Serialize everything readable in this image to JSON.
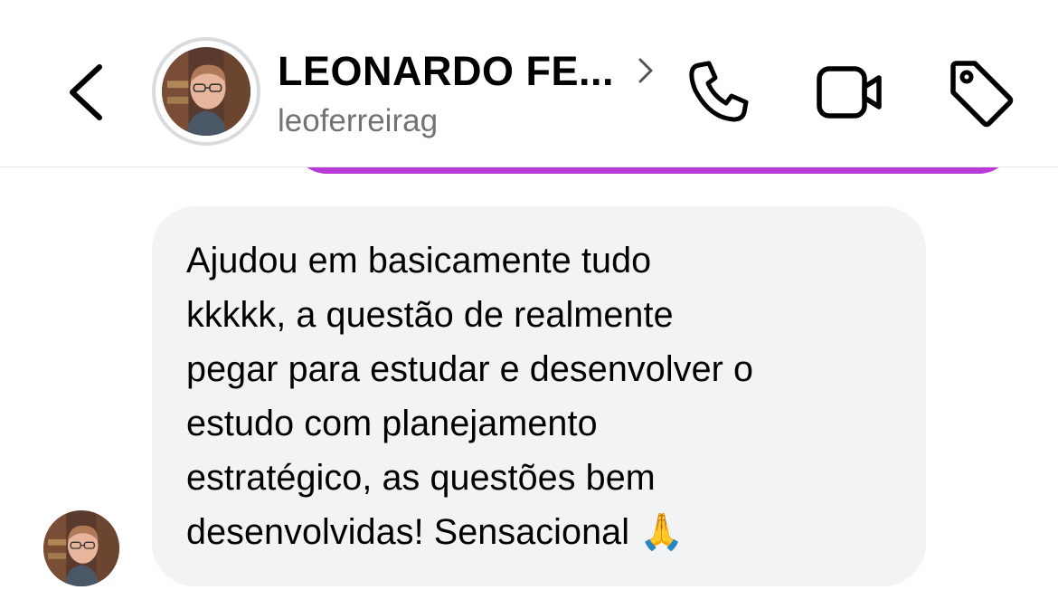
{
  "header": {
    "contact_name": "LEONARDO FE...",
    "username": "leoferreirag"
  },
  "message": {
    "text": "Ajudou em basicamente tudo\nkkkkk, a questão de realmente\npegar para estudar e desenvolver o\nestudo com planejamento\nestratégico, as questões bem\ndesenvolvidas! Sensacional 🙏"
  },
  "colors": {
    "sent_bubble": "#b73ad6",
    "received_bubble": "#f1f3f4",
    "secondary_text": "#737373",
    "icon": "#000000"
  },
  "icons": {
    "back": "chevron-left-icon",
    "profile_link": "chevron-right-icon",
    "call": "phone-icon",
    "video": "video-camera-icon",
    "tag": "tag-icon"
  }
}
